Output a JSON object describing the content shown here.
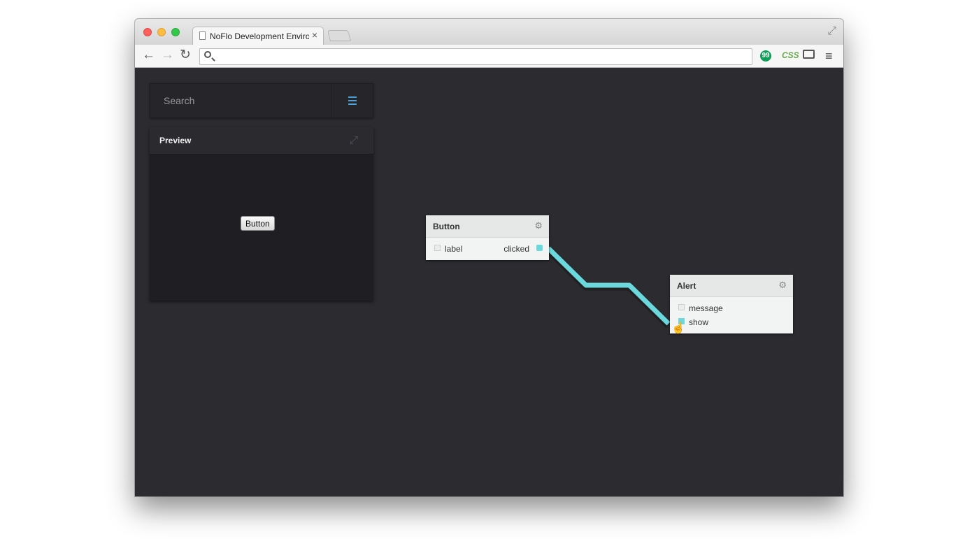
{
  "browser": {
    "tab_title": "NoFlo Development Environment",
    "tab_close": "×",
    "address": "",
    "extensions": {
      "css_label": "CSS",
      "hangouts_label": "99"
    }
  },
  "sidebar": {
    "search": {
      "placeholder": "Search",
      "value": ""
    },
    "preview": {
      "title": "Preview",
      "button_label": "Button"
    }
  },
  "graph": {
    "accent_color": "#6ad8dc",
    "nodes": [
      {
        "title": "Button",
        "inports": [
          {
            "label": "label",
            "connected": false
          }
        ],
        "outports": [
          {
            "label": "clicked",
            "connected": true
          }
        ]
      },
      {
        "title": "Alert",
        "inports": [
          {
            "label": "message",
            "connected": false
          },
          {
            "label": "show",
            "connected": true
          }
        ],
        "outports": []
      }
    ],
    "edges": [
      {
        "from": "Button.clicked",
        "to": "Alert.show"
      }
    ]
  }
}
